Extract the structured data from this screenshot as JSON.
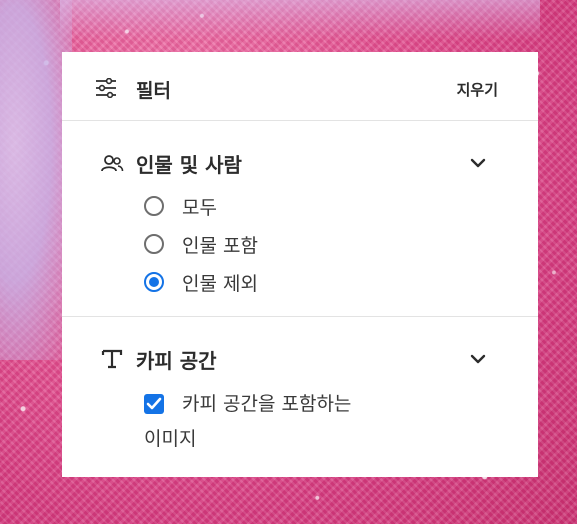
{
  "colors": {
    "accent": "#1473e6",
    "panel_bg": "#ffffff",
    "text": "#2c2c2c",
    "divider": "#e3e3e3",
    "background": "#e0508f"
  },
  "header": {
    "icon": "filter-sliders-icon",
    "title": "필터",
    "clear_label": "지우기"
  },
  "people_section": {
    "icon": "people-icon",
    "title": "인물 및 사람",
    "expanded": true,
    "options": [
      {
        "label": "모두",
        "selected": false
      },
      {
        "label": "인물 포함",
        "selected": false
      },
      {
        "label": "인물 제외",
        "selected": true
      }
    ]
  },
  "copy_space_section": {
    "icon": "text-t-icon",
    "title": "카피 공간",
    "expanded": true,
    "checkbox": {
      "label_line1": "카피 공간을 포함하는",
      "label_line2": "이미지",
      "checked": true
    }
  }
}
